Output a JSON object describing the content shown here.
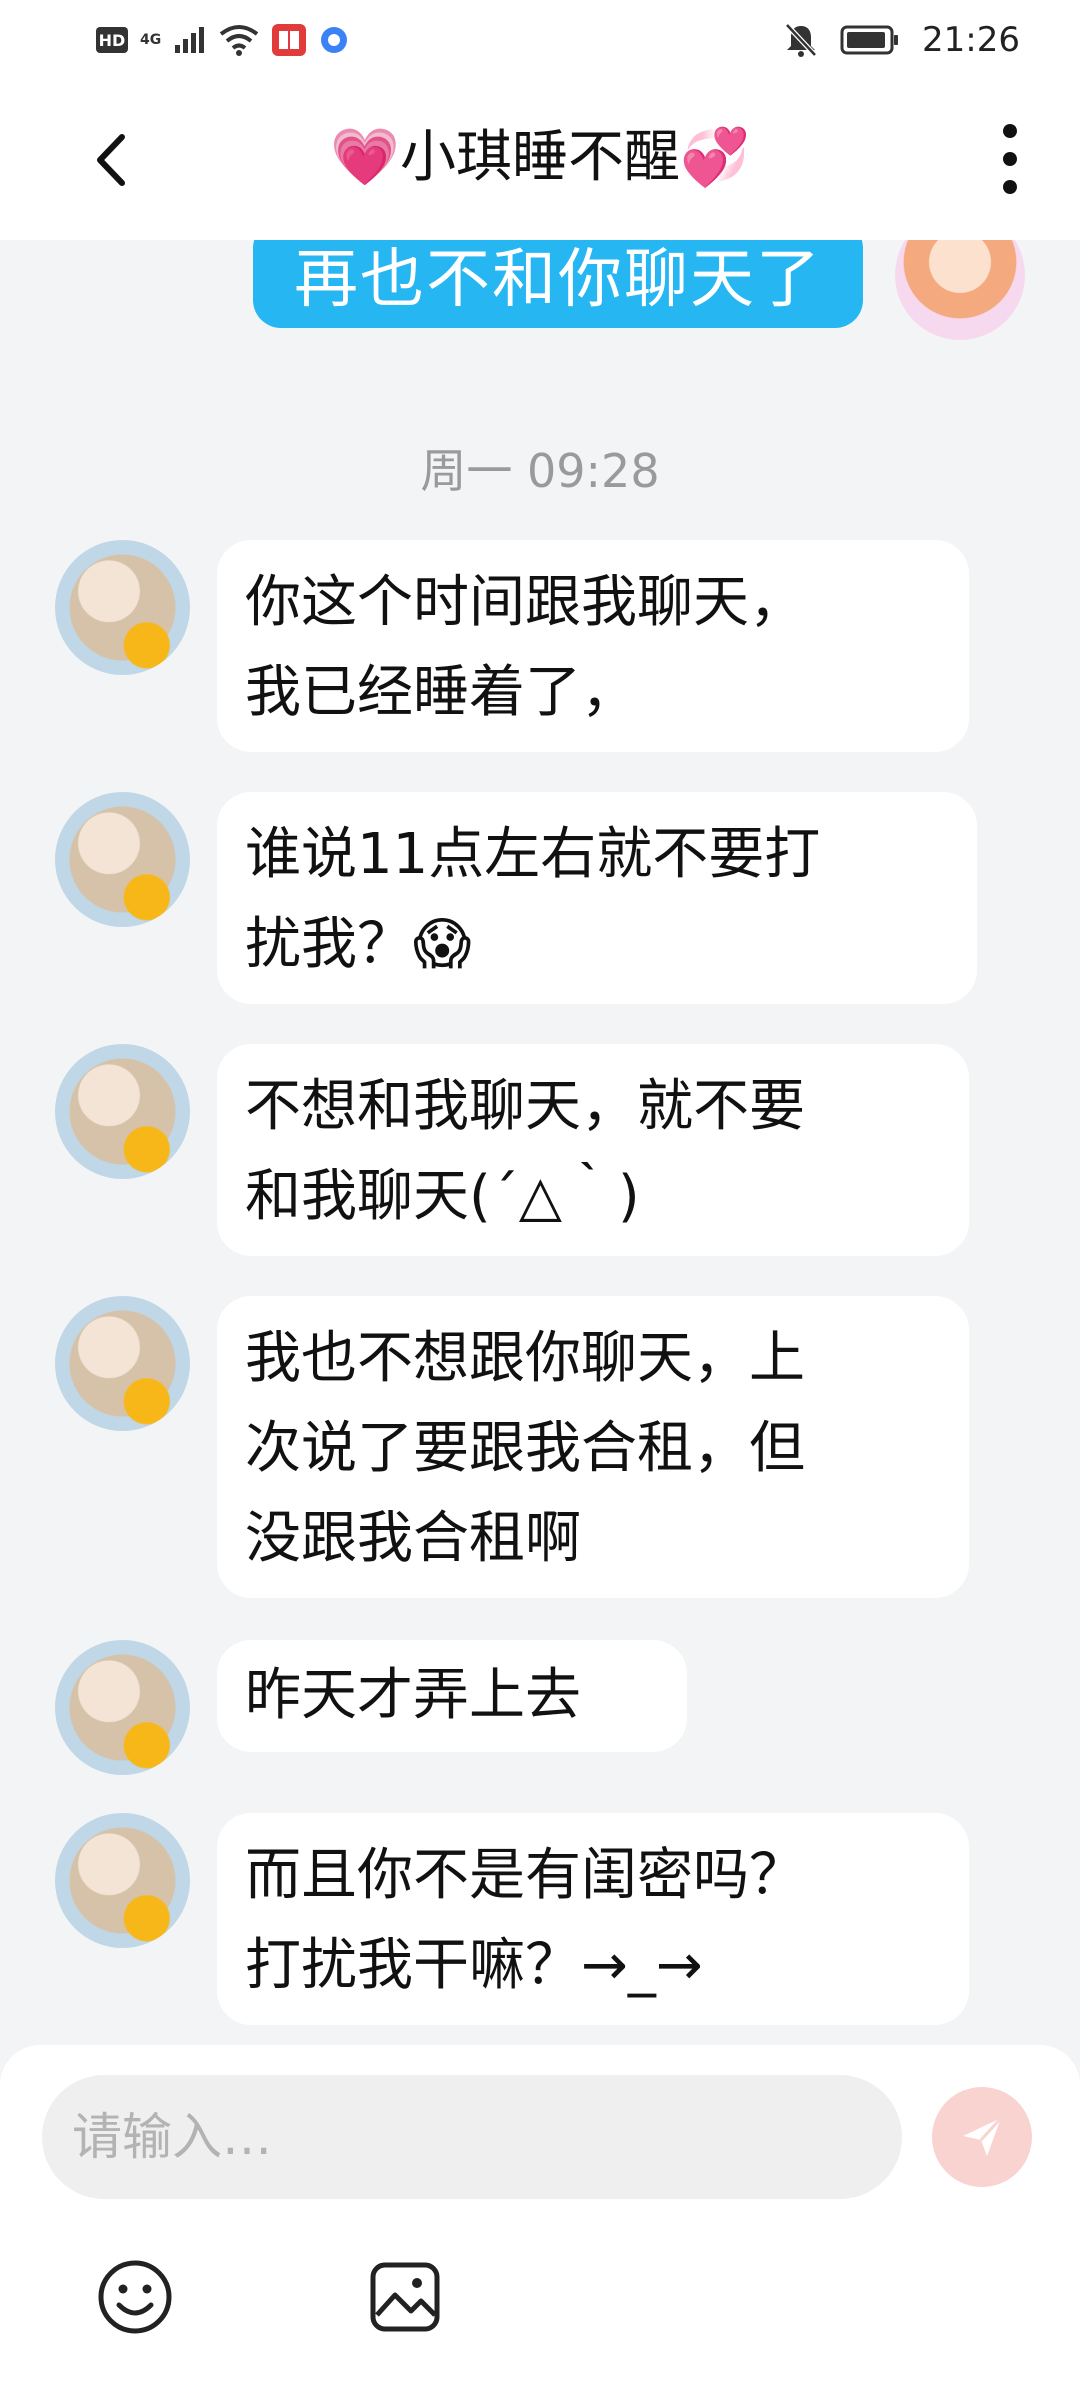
{
  "status_bar": {
    "hd": "HD",
    "network": "4G",
    "time": "21:26"
  },
  "header": {
    "title": "💗小琪睡不醒💞"
  },
  "chat": {
    "sent_message": "再也不和你聊天了",
    "timestamp": "周一 09:28",
    "messages": [
      {
        "text": "你这个时间跟我聊天，\n我已经睡着了，"
      },
      {
        "text": "谁说11点左右就不要打\n扰我？😱"
      },
      {
        "text": "不想和我聊天，就不要\n和我聊天(´△｀)"
      },
      {
        "text": "我也不想跟你聊天，上\n次说了要跟我合租，但\n没跟我合租啊"
      },
      {
        "text": "昨天才弄上去"
      },
      {
        "text": "而且你不是有闺密吗？\n打扰我干嘛？→_→"
      }
    ]
  },
  "input": {
    "placeholder": "请输入…"
  },
  "icons": {
    "back": "chevron-left-icon",
    "more": "more-vertical-icon",
    "send": "send-icon",
    "emoji": "emoji-icon",
    "image": "image-icon"
  },
  "colors": {
    "sent_bubble": "#26b6f2",
    "send_button": "#f9d3cf",
    "background": "#f3f4f6"
  }
}
